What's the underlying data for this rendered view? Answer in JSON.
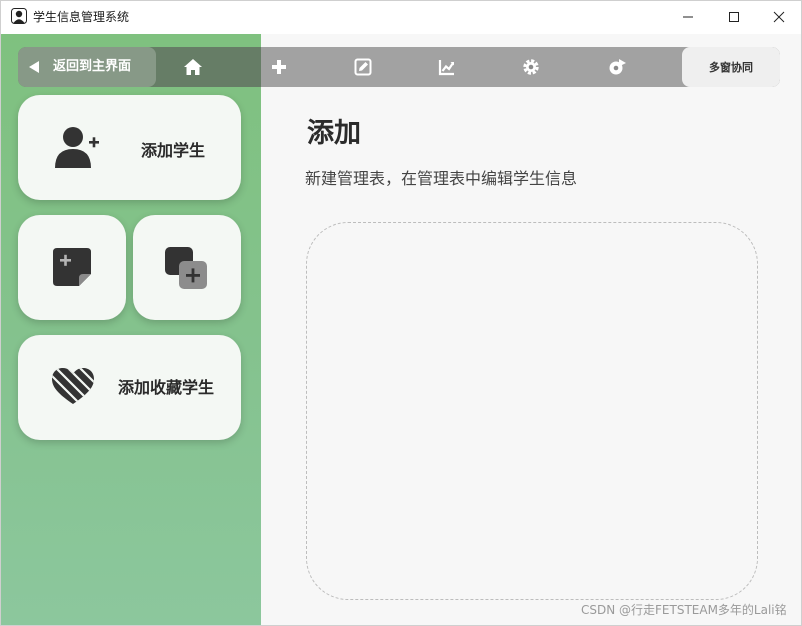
{
  "window": {
    "title": "学生信息管理系统"
  },
  "toolbar": {
    "back_label": "返回到主界面",
    "icons": [
      "home-icon",
      "plus-icon",
      "edit-icon",
      "chart-icon",
      "gear-icon",
      "share-icon"
    ],
    "multi_window_label": "多窗协同"
  },
  "sidebar": {
    "cards": [
      {
        "label": "添加学生",
        "icon": "add-user-icon"
      },
      {
        "label": "",
        "icon": "new-note-icon"
      },
      {
        "label": "",
        "icon": "copy-add-icon"
      },
      {
        "label": "添加收藏学生",
        "icon": "heart-icon"
      }
    ]
  },
  "main": {
    "title": "添加",
    "subtitle": "新建管理表，在管理表中编辑学生信息"
  },
  "watermark": "CSDN @行走FETSTEAM多年的Lali铭",
  "colors": {
    "sidebar": "#84c28d",
    "main_bg": "#f7f7f7",
    "card_bg": "#f4f8f4",
    "toolbar": "#8a8a8a"
  }
}
